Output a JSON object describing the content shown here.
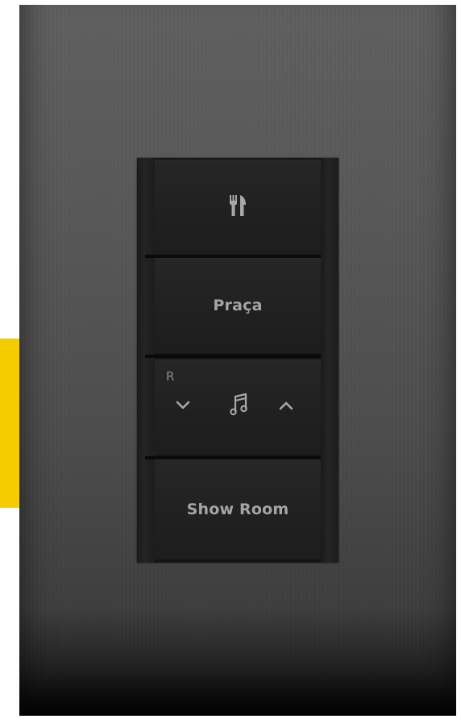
{
  "colors": {
    "accent": "#f5cc00",
    "plate": "#575757",
    "keypad": "#141414",
    "key_text": "#a5a5a5"
  },
  "keypad": {
    "key_1": {
      "icon": "utensils-icon"
    },
    "key_2": {
      "label": "Praça"
    },
    "key_3": {
      "corner_label": "R",
      "down_icon": "chevron-down-icon",
      "center_icon": "music-note-icon",
      "up_icon": "chevron-up-icon"
    },
    "key_4": {
      "label": "Show Room"
    }
  }
}
